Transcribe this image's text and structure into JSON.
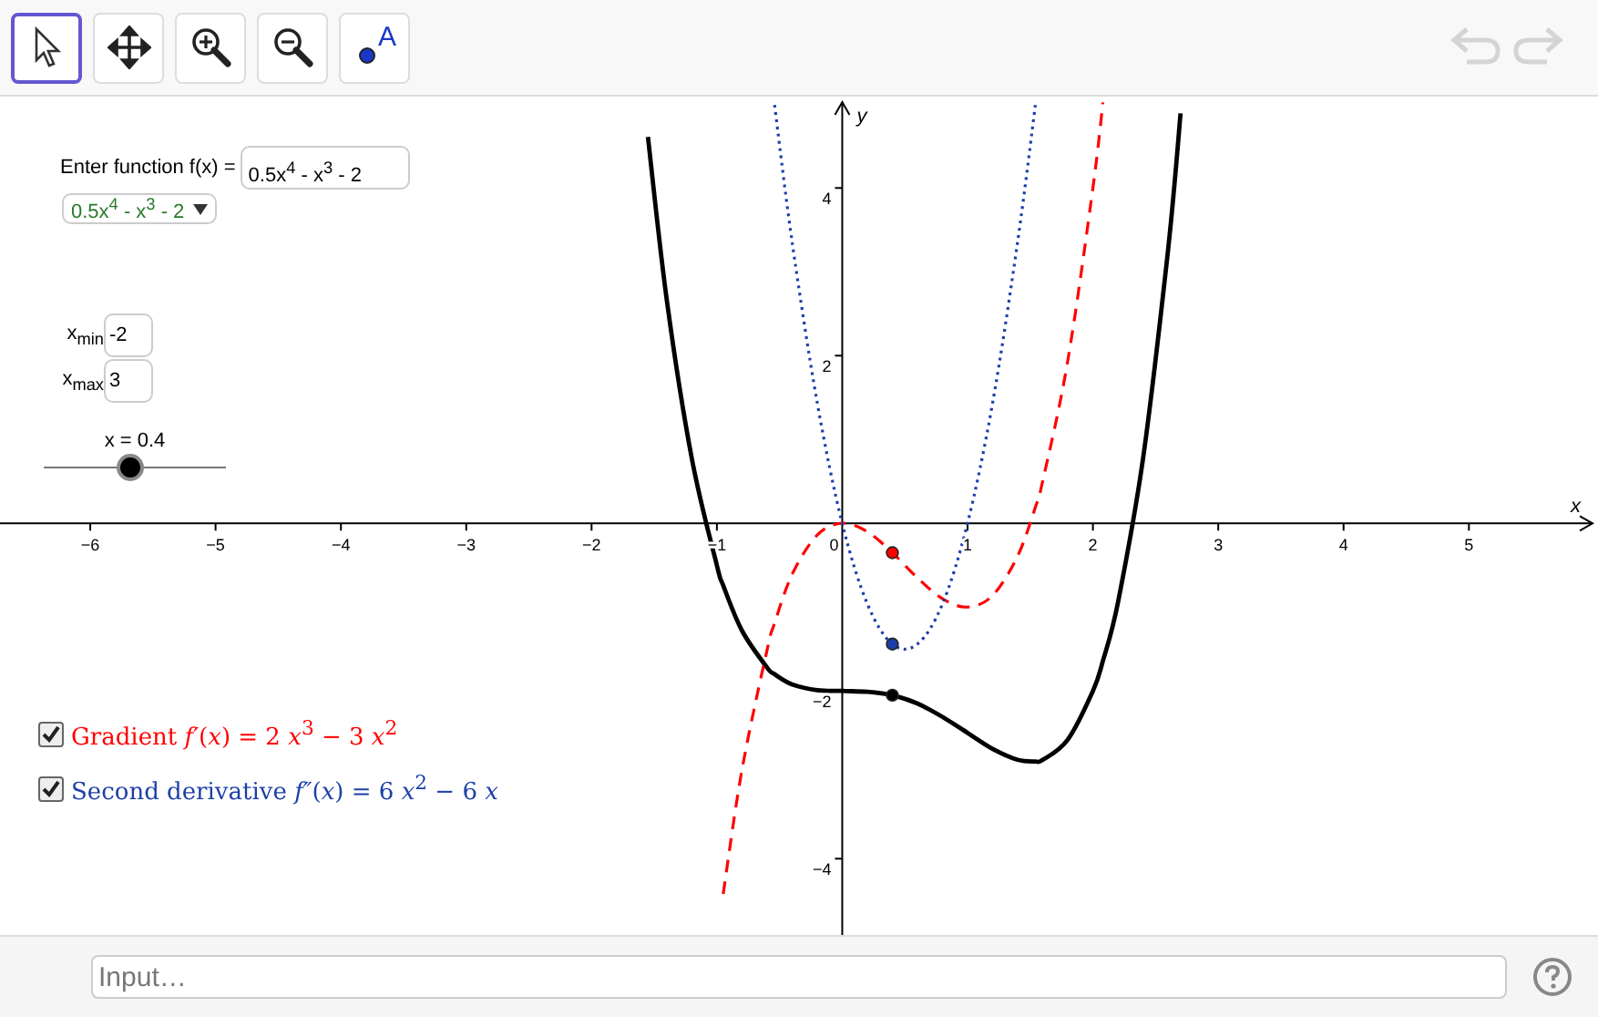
{
  "toolbar": {
    "tools": [
      {
        "kind": "select",
        "selected": true
      },
      {
        "kind": "move",
        "selected": false
      },
      {
        "kind": "zoom-in",
        "selected": false
      },
      {
        "kind": "zoom-out",
        "selected": false
      },
      {
        "kind": "point",
        "label": "A",
        "selected": false
      }
    ],
    "history": [
      {
        "kind": "undo",
        "disabled": true
      },
      {
        "kind": "redo",
        "disabled": true
      }
    ]
  },
  "panel": {
    "function_label": "Enter function f(x) =",
    "function_value": "0.5x$^{4}$ - x$^{3}$ - 2",
    "dropdown": "0.5x$^{4}$ - x$^{3}$ - 2",
    "bounds": [
      {
        "label": "x$_{min}$",
        "value": "-2"
      },
      {
        "label": "x$_{max}$",
        "value": "3"
      }
    ],
    "slider": {
      "label": "x = 0.4",
      "level": 0.48
    },
    "checkboxes": [
      {
        "label": "Gradient *f′*(*x*) = 2 *x*$^{3}$ − 3 *x*$^{2}$",
        "checked": true,
        "color": "#ff0000"
      },
      {
        "label": "Second derivative *f″*(*x*) = 6 *x*$^{2}$ − 6 *x*",
        "checked": true,
        "color": "#1c3fa8"
      }
    ]
  },
  "graph": {
    "chart_data": {
      "type": "line",
      "xlabel": "x",
      "ylabel": "y",
      "x": [
        -1.55,
        -1.4,
        -1.2,
        -1.0,
        -0.95,
        -0.8,
        -0.6,
        -0.54,
        -0.4,
        -0.2,
        0,
        0.2,
        0.4,
        0.6,
        0.8,
        1.0,
        1.2,
        1.4,
        1.54,
        1.6,
        1.8,
        2.0,
        2.08,
        2.2,
        2.4,
        2.6,
        2.7
      ],
      "series": [
        {
          "color": "#000000",
          "line_style": "solid",
          "values": [
            4.61,
            2.67,
            0.77,
            -0.5,
            -0.74,
            -1.28,
            -1.72,
            -1.8,
            -1.92,
            -1.99,
            -2,
            -2.01,
            -2.05,
            -2.15,
            -2.31,
            -2.5,
            -2.69,
            -2.82,
            -2.84,
            -2.82,
            -2.58,
            -2,
            -1.64,
            -0.94,
            0.77,
            3.27,
            4.89
          ]
        },
        {
          "color": "#ff0000",
          "line_style": "dashed",
          "values": [
            null,
            null,
            null,
            null,
            -4.42,
            -2.94,
            -1.51,
            -1.19,
            -0.61,
            -0.14,
            0,
            -0.1,
            -0.35,
            -0.65,
            -0.9,
            -1,
            -0.86,
            -0.39,
            0.19,
            0.51,
            1.94,
            4,
            5.02,
            null,
            null,
            null,
            null
          ]
        },
        {
          "color": "#1c3fa8",
          "line_style": "dotted",
          "values": [
            null,
            null,
            null,
            null,
            null,
            null,
            null,
            4.99,
            3.36,
            1.44,
            0,
            -0.96,
            -1.44,
            -1.44,
            -0.96,
            0,
            1.44,
            3.36,
            4.99,
            null,
            null,
            null,
            null,
            null,
            null,
            null,
            null
          ]
        }
      ],
      "xlim": [
        -6.72,
        6.03
      ],
      "ylim": [
        -4.91,
        5.09
      ],
      "xticks": [
        -6,
        -5,
        -4,
        -3,
        -2,
        -1,
        0,
        1,
        2,
        3,
        4,
        5
      ],
      "yticks": [
        -4,
        -2,
        2,
        4
      ]
    }
  },
  "input_bar": {
    "placeholder": "Input…"
  }
}
